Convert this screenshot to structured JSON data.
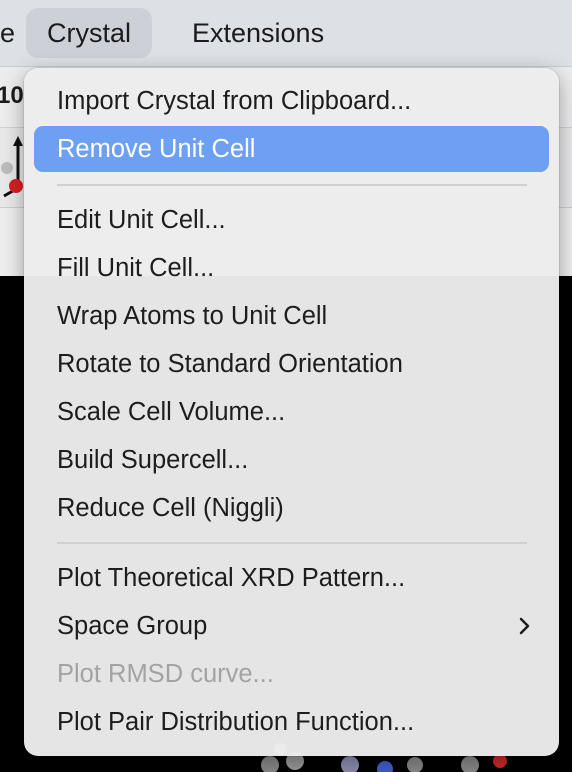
{
  "menubar": {
    "items": [
      {
        "label": "e",
        "partial": true
      },
      {
        "label": "Crystal",
        "active": true
      },
      {
        "label": "Extensions"
      }
    ]
  },
  "toolbar": {
    "partial_text": "10"
  },
  "crystal_menu": {
    "items": [
      {
        "label": "Import Crystal from Clipboard...",
        "state": "normal"
      },
      {
        "label": "Remove Unit Cell",
        "state": "highlighted"
      },
      {
        "label": "Edit Unit Cell...",
        "state": "normal"
      },
      {
        "label": "Fill Unit Cell...",
        "state": "normal"
      },
      {
        "label": "Wrap Atoms to Unit Cell",
        "state": "normal"
      },
      {
        "label": "Rotate to Standard Orientation",
        "state": "normal"
      },
      {
        "label": "Scale Cell Volume...",
        "state": "normal"
      },
      {
        "label": "Build Supercell...",
        "state": "normal"
      },
      {
        "label": "Reduce Cell (Niggli)",
        "state": "normal"
      },
      {
        "label": "Plot Theoretical XRD Pattern...",
        "state": "normal"
      },
      {
        "label": "Space Group",
        "state": "normal",
        "submenu": true
      },
      {
        "label": "Plot RMSD curve...",
        "state": "disabled"
      },
      {
        "label": "Plot Pair Distribution Function...",
        "state": "normal"
      }
    ]
  },
  "colors": {
    "highlight": "#6d9ff3",
    "menubar_bg": "#dde1e6",
    "disabled_text": "#a3a3a3"
  },
  "icons": {
    "submenu": "chevron-right-icon",
    "axis": "axis-icon"
  }
}
